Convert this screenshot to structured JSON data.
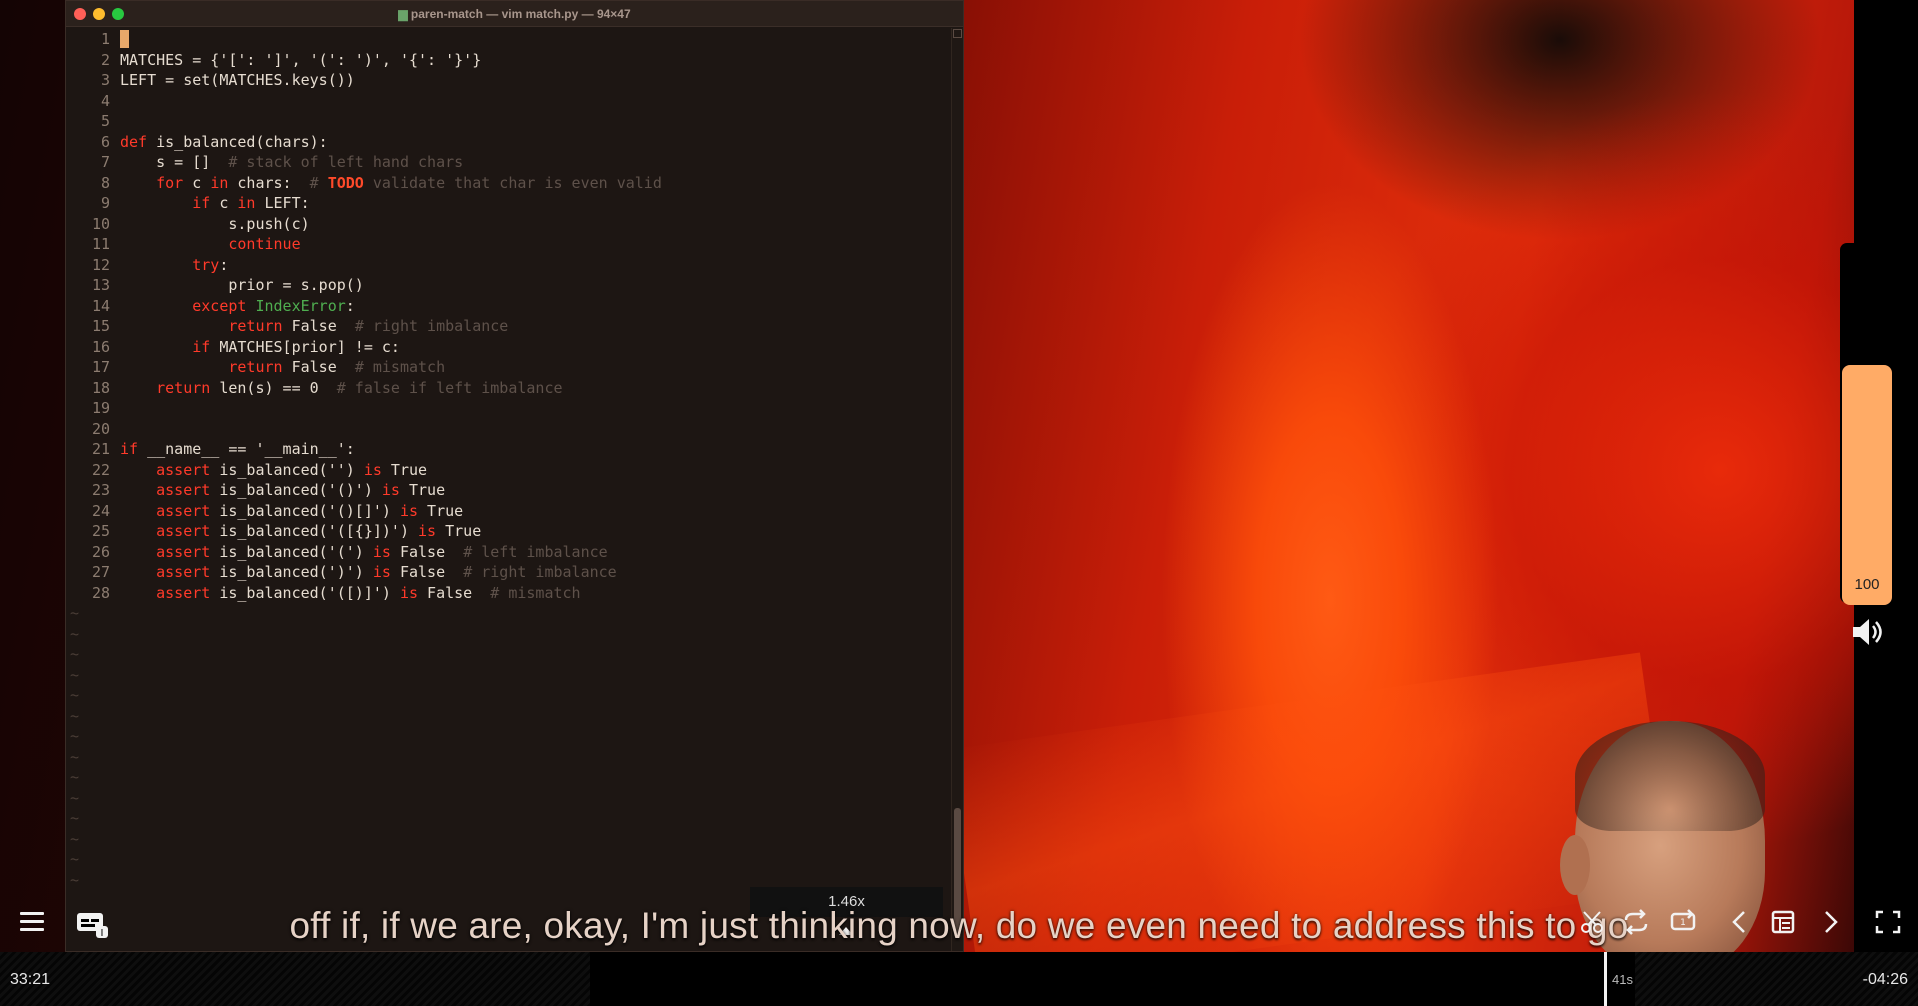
{
  "window": {
    "title": "paren-match — vim match.py — 94×47"
  },
  "editor": {
    "lines": [
      {
        "n": "1",
        "html": "<span class=\"cursor\"> </span>"
      },
      {
        "n": "2",
        "html": "MATCHES = {'[': ']', '(': ')', '{': '}'}"
      },
      {
        "n": "3",
        "html": "LEFT = set(MATCHES.keys())"
      },
      {
        "n": "4",
        "html": ""
      },
      {
        "n": "5",
        "html": ""
      },
      {
        "n": "6",
        "html": "<span class=\"kw\">def</span> is_balanced(chars):"
      },
      {
        "n": "7",
        "html": "    s = []  <span class=\"cm\"># stack of left hand chars</span>"
      },
      {
        "n": "8",
        "html": "    <span class=\"kw\">for</span> c <span class=\"kw\">in</span> chars:  <span class=\"cm\"># </span><span class=\"todo\">TODO</span><span class=\"cm\"> validate that char is even valid</span>"
      },
      {
        "n": "9",
        "html": "        <span class=\"kw\">if</span> c <span class=\"kw\">in</span> LEFT:"
      },
      {
        "n": "10",
        "html": "            s.push(c)"
      },
      {
        "n": "11",
        "html": "            <span class=\"kw\">continue</span>"
      },
      {
        "n": "12",
        "html": "        <span class=\"kw\">try</span>:"
      },
      {
        "n": "13",
        "html": "            prior = s.pop()"
      },
      {
        "n": "14",
        "html": "        <span class=\"kw\">except</span> <span class=\"ex\">IndexError</span>:"
      },
      {
        "n": "15",
        "html": "            <span class=\"kw\">return</span> False  <span class=\"cm\"># right imbalance</span>"
      },
      {
        "n": "16",
        "html": "        <span class=\"kw\">if</span> MATCHES[prior] != c:"
      },
      {
        "n": "17",
        "html": "            <span class=\"kw\">return</span> False  <span class=\"cm\"># mismatch</span>"
      },
      {
        "n": "18",
        "html": "    <span class=\"kw\">return</span> len(s) == 0  <span class=\"cm\"># false if left imbalance</span>"
      },
      {
        "n": "19",
        "html": ""
      },
      {
        "n": "20",
        "html": ""
      },
      {
        "n": "21",
        "html": "<span class=\"kw\">if</span> __name__ == '__main__':"
      },
      {
        "n": "22",
        "html": "    <span class=\"kw\">assert</span> is_balanced('') <span class=\"kw\">is</span> True"
      },
      {
        "n": "23",
        "html": "    <span class=\"kw\">assert</span> is_balanced('()') <span class=\"kw\">is</span> True"
      },
      {
        "n": "24",
        "html": "    <span class=\"kw\">assert</span> is_balanced('()[]') <span class=\"kw\">is</span> True"
      },
      {
        "n": "25",
        "html": "    <span class=\"kw\">assert</span> is_balanced('([{}])') <span class=\"kw\">is</span> True"
      },
      {
        "n": "26",
        "html": "    <span class=\"kw\">assert</span> is_balanced('(') <span class=\"kw\">is</span> False  <span class=\"cm\"># left imbalance</span>"
      },
      {
        "n": "27",
        "html": "    <span class=\"kw\">assert</span> is_balanced(')') <span class=\"kw\">is</span> False  <span class=\"cm\"># right imbalance</span>"
      },
      {
        "n": "28",
        "html": "    <span class=\"kw\">assert</span> is_balanced('([)]') <span class=\"kw\">is</span> False  <span class=\"cm\"># mismatch</span>"
      }
    ],
    "tilde_count": 14,
    "tilde_char": "~"
  },
  "player": {
    "speed_label": "1.46x",
    "subtitle": "off if, if we are, okay, I'm just thinking now, do we even need to address this to go",
    "volume_value": "100",
    "volume_level_percent": 100,
    "time_elapsed": "33:21",
    "time_remaining": "-04:26",
    "playhead_label": "41s"
  },
  "icons": {
    "menu": "hamburger-menu-icon",
    "subtitles": "subtitles-icon",
    "speaker": "speaker-icon",
    "cut": "cut-icon",
    "loop": "loop-icon",
    "repeat": "repeat-icon",
    "prev": "chevron-left-icon",
    "chapters": "chapters-icon",
    "next": "chevron-right-icon",
    "fullscreen": "fullscreen-icon"
  },
  "colors": {
    "accent": "#ffab66",
    "keyword": "#ff3a2a",
    "comment": "#5e514a",
    "exception": "#4fae50"
  }
}
